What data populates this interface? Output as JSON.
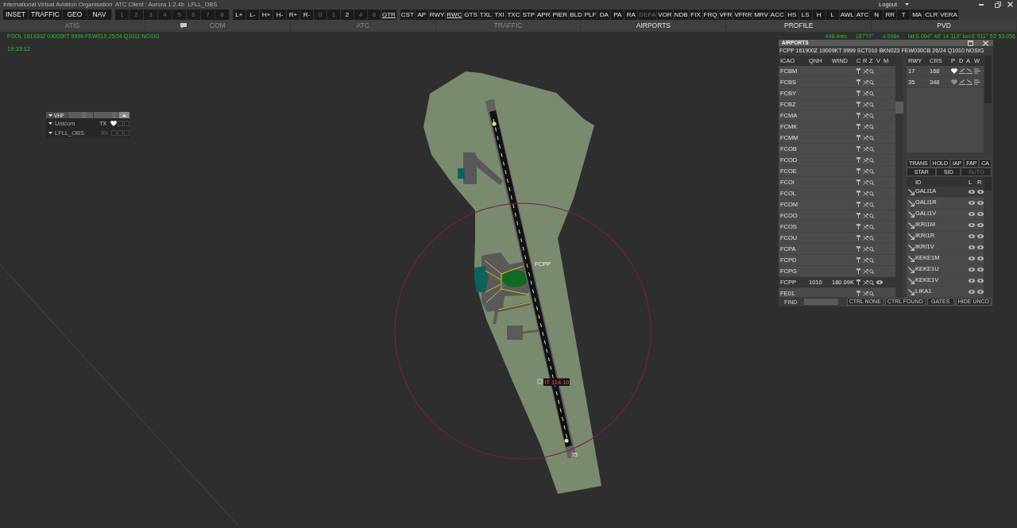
{
  "window": {
    "title": "International Virtual Aviation Organisation  ATC Client : Aurora 1.2.4b  LFLL_OBS",
    "menu": "Logout"
  },
  "toolbar": {
    "groups": [
      [
        {
          "label": "INSET",
          "dimmed": false,
          "underlined": false
        },
        {
          "label": "TRAFFIC",
          "dimmed": false,
          "underlined": false
        },
        {
          "label": "GEO",
          "dimmed": false,
          "underlined": false
        },
        {
          "label": "NAV",
          "dimmed": false,
          "underlined": false
        }
      ],
      [
        {
          "label": "1",
          "dimmed": true,
          "underlined": false
        },
        {
          "label": "2",
          "dimmed": true,
          "underlined": false
        },
        {
          "label": "3",
          "dimmed": true,
          "underlined": false
        },
        {
          "label": "4",
          "dimmed": true,
          "underlined": false
        },
        {
          "label": "5",
          "dimmed": true,
          "underlined": false
        },
        {
          "label": "6",
          "dimmed": true,
          "underlined": false
        },
        {
          "label": "7",
          "dimmed": true,
          "underlined": false
        },
        {
          "label": "8",
          "dimmed": true,
          "underlined": false
        }
      ],
      [
        {
          "label": "L+",
          "dimmed": false,
          "underlined": false
        },
        {
          "label": "L-",
          "dimmed": false,
          "underlined": false
        },
        {
          "label": "H+",
          "dimmed": false,
          "underlined": false
        },
        {
          "label": "H-",
          "dimmed": false,
          "underlined": false
        },
        {
          "label": "R+",
          "dimmed": false,
          "underlined": false
        },
        {
          "label": "R-",
          "dimmed": false,
          "underlined": false
        },
        {
          "label": "0",
          "dimmed": true,
          "underlined": false
        },
        {
          "label": "1",
          "dimmed": true,
          "underlined": false
        },
        {
          "label": "2",
          "dimmed": false,
          "underlined": false
        },
        {
          "label": "4",
          "dimmed": true,
          "underlined": false
        },
        {
          "label": "8",
          "dimmed": true,
          "underlined": false
        },
        {
          "label": "GTR",
          "dimmed": false,
          "underlined": true
        }
      ],
      [
        {
          "label": "CST",
          "dimmed": false,
          "underlined": false
        },
        {
          "label": "AP",
          "dimmed": false,
          "underlined": false
        },
        {
          "label": "RWY",
          "dimmed": false,
          "underlined": false
        },
        {
          "label": "RWC",
          "dimmed": false,
          "underlined": true
        },
        {
          "label": "GTS",
          "dimmed": false,
          "underlined": false
        },
        {
          "label": "TXL",
          "dimmed": false,
          "underlined": false
        },
        {
          "label": "TXI",
          "dimmed": false,
          "underlined": false
        },
        {
          "label": "TXC",
          "dimmed": false,
          "underlined": false
        },
        {
          "label": "STP",
          "dimmed": false,
          "underlined": false
        },
        {
          "label": "APR",
          "dimmed": false,
          "underlined": false
        },
        {
          "label": "PIER",
          "dimmed": false,
          "underlined": false
        },
        {
          "label": "BLD",
          "dimmed": false,
          "underlined": false
        },
        {
          "label": "PLF",
          "dimmed": false,
          "underlined": false
        },
        {
          "label": "DA",
          "dimmed": false,
          "underlined": false
        },
        {
          "label": "PA",
          "dimmed": false,
          "underlined": false
        },
        {
          "label": "RA",
          "dimmed": false,
          "underlined": false
        },
        {
          "label": "DEFA",
          "dimmed": true,
          "underlined": false
        },
        {
          "label": "VOR",
          "dimmed": false,
          "underlined": false
        },
        {
          "label": "NDB",
          "dimmed": false,
          "underlined": false
        },
        {
          "label": "FIX",
          "dimmed": false,
          "underlined": false
        },
        {
          "label": "FRQ",
          "dimmed": false,
          "underlined": false
        },
        {
          "label": "VFR",
          "dimmed": false,
          "underlined": false
        },
        {
          "label": "VFRR",
          "dimmed": false,
          "underlined": false
        },
        {
          "label": "MRV",
          "dimmed": false,
          "underlined": false
        },
        {
          "label": "ACC",
          "dimmed": false,
          "underlined": false
        },
        {
          "label": "HS",
          "dimmed": false,
          "underlined": false
        },
        {
          "label": "LS",
          "dimmed": false,
          "underlined": false
        },
        {
          "label": "H",
          "dimmed": false,
          "underlined": false
        },
        {
          "label": "L",
          "dimmed": false,
          "underlined": false
        },
        {
          "label": "AWL",
          "dimmed": false,
          "underlined": false
        },
        {
          "label": "ATC",
          "dimmed": false,
          "underlined": false
        },
        {
          "label": "N",
          "dimmed": false,
          "underlined": false
        },
        {
          "label": "RR",
          "dimmed": false,
          "underlined": false
        },
        {
          "label": "T",
          "dimmed": false,
          "underlined": false
        },
        {
          "label": "MA",
          "dimmed": false,
          "underlined": false
        },
        {
          "label": "CLR",
          "dimmed": false,
          "underlined": false
        },
        {
          "label": "VERA",
          "dimmed": false,
          "underlined": false
        }
      ]
    ]
  },
  "tabs": [
    {
      "label": "ATIS",
      "lit": false,
      "notification": false
    },
    {
      "label": "COM",
      "lit": false,
      "notification": true
    },
    {
      "label": "ATC",
      "lit": false,
      "notification": false
    },
    {
      "label": "TRAFFIC",
      "lit": false,
      "notification": false
    },
    {
      "label": "AIRPORTS",
      "lit": true,
      "notification": false
    },
    {
      "label": "PROFILE",
      "lit": true,
      "notification": false
    },
    {
      "label": "PVD",
      "lit": true,
      "notification": false
    }
  ],
  "status": {
    "metar": "FOOL 161930Z 03002KT 9999 FEW010 25/24 Q1011 NOSIG",
    "readout": [
      "448.4nm",
      "187°/7°",
      "± 596x",
      "lat:S 004° 48' 14.110\" lon:E 011° 53' 53.056"
    ],
    "time": "19:33:12"
  },
  "vhf": {
    "title": "VHF",
    "sliders": [
      {
        "level": 0.65
      },
      {
        "level": 0.85
      }
    ],
    "rows": [
      {
        "name": "Unicom",
        "mode": "TX",
        "transmit": true,
        "checks": [
          {
            "checked": false
          },
          {
            "checked": false
          }
        ]
      },
      {
        "name": "LFLL_OBS",
        "mode": "RX",
        "transmit": false,
        "checks": [
          {
            "checked": false
          },
          {
            "checked": false
          }
        ]
      }
    ]
  },
  "map": {
    "labels": [
      {
        "kind": "airport",
        "text": "FCPP"
      },
      {
        "kind": "navaid",
        "text": "IT 114.10"
      },
      {
        "kind": "runway",
        "text": "35"
      }
    ]
  },
  "airports": {
    "title": "AIRPORTS",
    "metar": "FCPP 161900Z 19009KT 9999 SCT010 BKN023 FEW030CB 26/24 Q1010 NOSIG",
    "columns": [
      "ICAO",
      "QNH",
      "WIND",
      "C",
      "R",
      "Z",
      "V",
      "M"
    ],
    "rows": [
      {
        "icao": "FCBM",
        "visible": false,
        "selected": false
      },
      {
        "icao": "FCBS",
        "visible": false,
        "selected": false
      },
      {
        "icao": "FCBY",
        "visible": false,
        "selected": false
      },
      {
        "icao": "FCBZ",
        "visible": false,
        "selected": false
      },
      {
        "icao": "FCMA",
        "visible": false,
        "selected": false
      },
      {
        "icao": "FCMK",
        "visible": false,
        "selected": false
      },
      {
        "icao": "FCMM",
        "visible": false,
        "selected": false
      },
      {
        "icao": "FCOB",
        "visible": false,
        "selected": false
      },
      {
        "icao": "FCOD",
        "visible": false,
        "selected": false
      },
      {
        "icao": "FCOE",
        "visible": false,
        "selected": false
      },
      {
        "icao": "FCOI",
        "visible": false,
        "selected": false
      },
      {
        "icao": "FCOL",
        "visible": false,
        "selected": false
      },
      {
        "icao": "FCOM",
        "visible": false,
        "selected": false
      },
      {
        "icao": "FCOO",
        "visible": false,
        "selected": false
      },
      {
        "icao": "FCOS",
        "visible": false,
        "selected": false
      },
      {
        "icao": "FCOU",
        "visible": false,
        "selected": false
      },
      {
        "icao": "FCPA",
        "visible": false,
        "selected": false
      },
      {
        "icao": "FCPD",
        "visible": false,
        "selected": false
      },
      {
        "icao": "FCPG",
        "visible": false,
        "selected": false
      },
      {
        "icao": "FCPP",
        "qnh": "1010",
        "wind": "180 09K",
        "visible": true,
        "selected": true
      },
      {
        "icao": "FE01",
        "visible": false,
        "selected": false
      }
    ],
    "runways": {
      "columns": [
        "RWY",
        "CRS",
        "P",
        "D",
        "A",
        "W"
      ],
      "rows": [
        {
          "rwy": "17",
          "crs": "168",
          "primary": true
        },
        {
          "rwy": "35",
          "crs": "348",
          "primary": false
        }
      ]
    },
    "procedure_tabs": [
      [
        {
          "label": "TRANS",
          "dimmed": false
        },
        {
          "label": "HOLD",
          "dimmed": false
        },
        {
          "label": "IAP",
          "dimmed": false
        },
        {
          "label": "FAP",
          "dimmed": false
        },
        {
          "label": "CA",
          "dimmed": false
        }
      ],
      [
        {
          "label": "STAR",
          "dimmed": false
        },
        {
          "label": "SID",
          "dimmed": false
        },
        {
          "label": "AUTO",
          "dimmed": true
        }
      ]
    ],
    "procedures": {
      "columns": [
        "ID",
        "L",
        "R"
      ],
      "rows": [
        {
          "id": "GALI1A",
          "selected": true
        },
        {
          "id": "GALI1R",
          "selected": false
        },
        {
          "id": "GALI1V",
          "selected": false
        },
        {
          "id": "IKRI1M",
          "selected": false
        },
        {
          "id": "IKRI1R",
          "selected": false
        },
        {
          "id": "IKRI1V",
          "selected": false
        },
        {
          "id": "KEKE1M",
          "selected": false
        },
        {
          "id": "KEKE1U",
          "selected": false
        },
        {
          "id": "KEKE1V",
          "selected": false
        },
        {
          "id": "LIKA1",
          "selected": false
        }
      ]
    },
    "find": {
      "label": "FIND"
    },
    "buttons": [
      "CTRL NONE",
      "CTRL FOUND",
      "GATES",
      "HIDE UNCO"
    ]
  }
}
